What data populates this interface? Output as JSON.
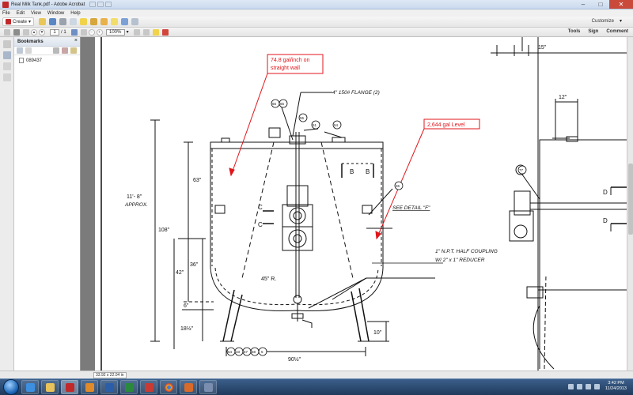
{
  "window": {
    "title": "Real Milk Tank.pdf - Adobe Acrobat"
  },
  "menu": [
    "File",
    "Edit",
    "View",
    "Window",
    "Help"
  ],
  "toolbar": {
    "create_label": "Create",
    "customize_label": "Customize"
  },
  "navigation": {
    "current_page": "1",
    "total_pages": "/ 1",
    "zoom": "100%"
  },
  "panels": {
    "tools": "Tools",
    "sign": "Sign",
    "comment": "Comment"
  },
  "bookmarks": {
    "header": "Bookmarks",
    "items": [
      "089437"
    ]
  },
  "drawing": {
    "callout_1": [
      "74.8 gal/inch on",
      "straight wall"
    ],
    "callout_2": "2,644 gal Level",
    "flange_note": "4\" 150# FLANGE (2)",
    "detail_note": "SEE DETAIL \"F\"",
    "coupling_note_1": "1\" N.P.T. HALF COUPLING",
    "coupling_note_2": "W/ 2\" x 1\" REDUCER",
    "overall_height": "11'- 8\"",
    "approx": "APPROX.",
    "dim_63": "63\"",
    "dim_108": "108\"",
    "dim_42": "42\"",
    "dim_36": "36\"",
    "dim_6": "6\"",
    "dim_18half": "18½\"",
    "dim_90half": "90½\"",
    "dim_10": "10\"",
    "dim_12": "12\"",
    "dim_15": "15\"",
    "radius": "45\" R.",
    "section_b": "B",
    "section_c": "C",
    "section_d": "D",
    "balloon_65": "65",
    "balloon_66": "66",
    "balloon_55": "55",
    "balloon_51": "51",
    "balloon_54": "54",
    "balloon_36": "36",
    "balloon_77": "77",
    "balloon_bottom": [
      "54",
      "33",
      "57",
      "58",
      "5"
    ]
  },
  "statusbar": {
    "page_size": "33.92 x 22.04 in"
  },
  "taskbar": {
    "time": "3:42 PM",
    "date": "11/24/2013"
  },
  "colors": {
    "callout_red": "#e0161b",
    "drawing_line": "#111111",
    "title_bar": "#c9d9ee",
    "taskbar": "#203a5c"
  }
}
